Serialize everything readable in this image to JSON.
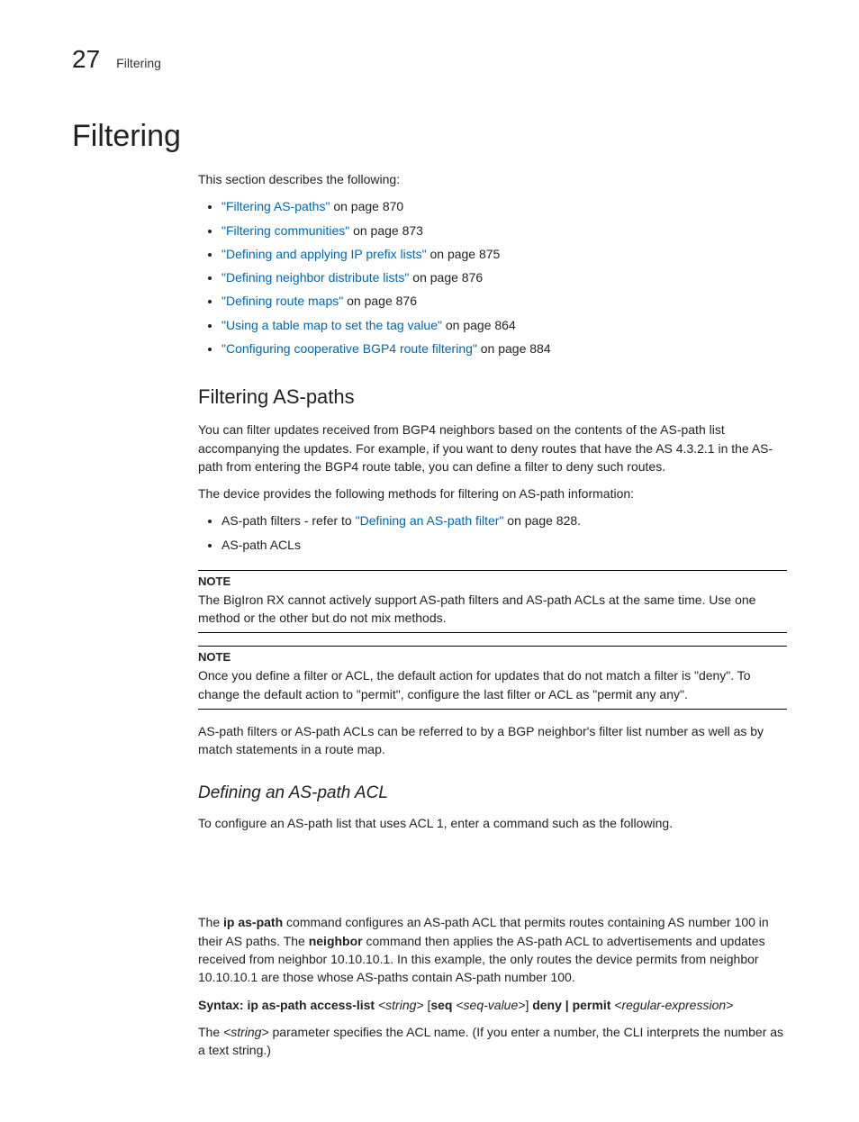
{
  "header": {
    "chapter_number": "27",
    "chapter_label": "Filtering"
  },
  "h1": "Filtering",
  "intro": "This section describes the following:",
  "toc": [
    {
      "link": "\"Filtering AS-paths\"",
      "suffix": " on page 870"
    },
    {
      "link": "\"Filtering communities\"",
      "suffix": " on page 873"
    },
    {
      "link": "\"Defining and applying IP prefix lists\"",
      "suffix": " on page 875"
    },
    {
      "link": "\"Defining neighbor distribute lists\"",
      "suffix": " on page 876"
    },
    {
      "link": "\"Defining route maps\"",
      "suffix": " on page 876"
    },
    {
      "link": "\"Using a table map to set the tag value\"",
      "suffix": " on page 864"
    },
    {
      "link": "\"Configuring cooperative BGP4 route filtering\"",
      "suffix": " on page 884"
    }
  ],
  "h2_aspaths": "Filtering AS-paths",
  "p_aspaths_1": "You can filter updates received from BGP4 neighbors based on the contents of the AS-path list accompanying the updates.  For example, if you want to deny routes that have the AS 4.3.2.1 in the AS-path from entering the BGP4 route table, you can define a filter to deny such routes.",
  "p_aspaths_2": "The device provides the following methods for filtering on AS-path information:",
  "methods": {
    "item1_prefix": "AS-path filters - refer to ",
    "item1_link": "\"Defining an AS-path filter\"",
    "item1_suffix": " on page 828.",
    "item2": "AS-path ACLs"
  },
  "note1": {
    "head": "NOTE",
    "body": "The BigIron RX cannot actively support AS-path filters and AS-path ACLs at the same time. Use one method or the other but do not mix methods."
  },
  "note2": {
    "head": "NOTE",
    "body": "Once you define a filter or ACL, the default action for updates that do not match a filter is \"deny\". To change the default action to \"permit\", configure the last filter or ACL as \"permit any any\"."
  },
  "p_refer": "AS-path filters or AS-path ACLs can be referred to by a BGP neighbor's filter list number as well as by match statements in a route map.",
  "h3_acl": "Defining an AS-path ACL",
  "p_acl_1": "To configure an AS-path list that uses ACL 1, enter a command such as the following.",
  "p_acl_2a": "The ",
  "p_acl_2_cmd1": "ip as-path",
  "p_acl_2b": " command configures an AS-path ACL that permits routes containing AS number 100 in their AS paths. The ",
  "p_acl_2_cmd2": "neighbor",
  "p_acl_2c": " command then applies the AS-path ACL to advertisements and updates received from neighbor 10.10.10.1. In this example, the only routes the device permits from neighbor 10.10.10.1 are those whose AS-paths contain AS-path number 100.",
  "syntax": {
    "label": "Syntax:  ",
    "cmd": "ip as-path access-list ",
    "arg1": "<string>",
    "mid1": " [",
    "seq": "seq ",
    "arg2": "<seq-value>",
    "mid2": "] ",
    "deny_permit": "deny | permit ",
    "arg3": "<regular-expression>"
  },
  "p_string_1": "The ",
  "p_string_arg": "<string>",
  "p_string_2": " parameter specifies the ACL name.  (If you enter a number, the CLI interprets the number as a text string.)"
}
